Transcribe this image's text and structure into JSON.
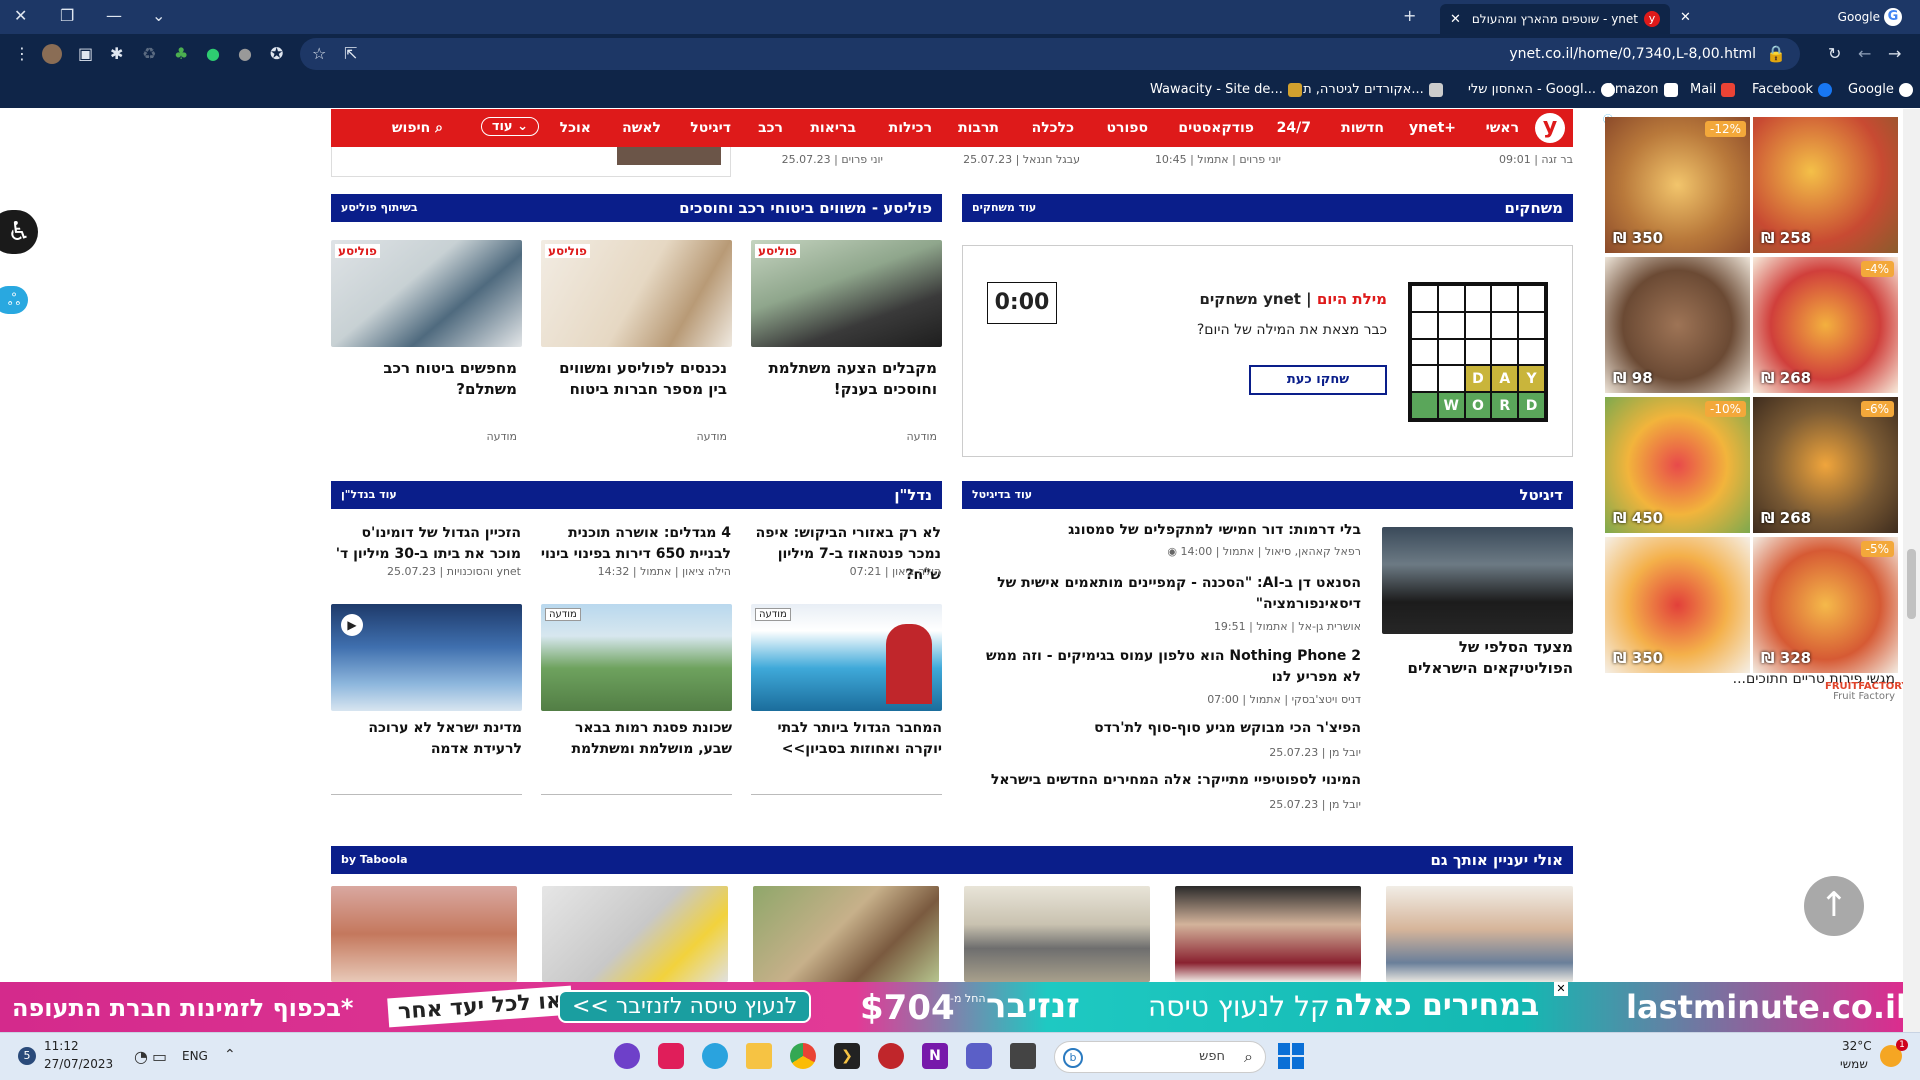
{
  "browser": {
    "tabs": [
      {
        "title": "Google",
        "active": false
      },
      {
        "title": "ynet - שוטפים מהארץ ומהעולם ם",
        "active": true
      }
    ],
    "url": "ynet.co.il/home/0,7340,L-8,00.html",
    "bookmarks": [
      {
        "label": "Google"
      },
      {
        "label": "Facebook"
      },
      {
        "label": "Mail"
      },
      {
        "label": "Amazon"
      },
      {
        "label": "האחסון שלי - Googl..."
      },
      {
        "label": "אקורדים לגיטרה, תוו..."
      },
      {
        "label": "Wawacity - Site de..."
      }
    ]
  },
  "nav": {
    "logo": "y",
    "items": [
      "ראשי",
      "ynet+",
      "חדשות",
      "24/7",
      "פודקאסטים",
      "ספורט",
      "כלכלה",
      "תרבות",
      "רכילות",
      "בריאות",
      "רכב",
      "דיגיטל",
      "לאשה",
      "אוכל"
    ],
    "more": "עוד",
    "search": "חיפוש"
  },
  "top_meta": [
    {
      "author": "בר זגה",
      "time": "09:01"
    },
    {
      "author": "יוני פרוים | אתמול",
      "time": "10:45"
    },
    {
      "author": "עבגל חננאל",
      "time": "25.07.23"
    },
    {
      "author": "יוני פרוים",
      "time": "25.07.23"
    }
  ],
  "games": {
    "title": "משחקים",
    "more": "עוד משחקים",
    "brand_red": "מילת היום",
    "brand_black": "ynet משחקים",
    "question": "כבר מצאת את המילה של היום?",
    "button": "שחקו כעת",
    "timer": "0:00",
    "grid_row4": [
      "Y",
      "A",
      "D"
    ],
    "grid_row5": [
      "D",
      "R",
      "O",
      "W"
    ]
  },
  "polisa": {
    "title": "פוליסע - משווים ביטוחי רכב וחוסכים",
    "partner": "בשיתוף פוליסע",
    "logo_text": "פוליסע",
    "cards": [
      {
        "headline": "מקבלים הצעה משתלמת וחוסכים בענק!",
        "label": "מודעה"
      },
      {
        "headline": "נכנסים לפוליסע ומשווים בין מספר חברות ביטוח",
        "label": "מודעה"
      },
      {
        "headline": "מחפשים ביטוח רכב משתלם?",
        "label": "מודעה"
      }
    ]
  },
  "digital": {
    "title": "דיגיטל",
    "more": "עוד בדיגיטל",
    "main_headline": "מצעד הסלפי של הפוליטיקאים הישראלים",
    "items": [
      {
        "headline": "בלי דרמות: דור חמישי למתקפלים של סמסונג",
        "meta": "רפאל קאהאן, סיאול | אתמול | 14:00"
      },
      {
        "headline": "הסנאט דן ב-AI: \"הסכנה - קמפיינים מותאמים אישית של דיסאינפורמציה\"",
        "meta": "אושרית גן-אל | אתמול | 19:51"
      },
      {
        "headline": "Nothing Phone 2 הוא טלפון עמוס בגימיקים - וזה ממש לא מפריע לנו",
        "meta": "דניס ויטצ'בסקי | אתמול | 07:00"
      },
      {
        "headline": "הפיצ'ר הכי מבוקש מגיע סוף-סוף לת'רדס",
        "meta": "יובל מן | 25.07.23"
      },
      {
        "headline": "המינוי לספוטיפיי מתייקר: אלה המחירים החדשים בישראל",
        "meta": "יובל מן | 25.07.23"
      }
    ]
  },
  "nadlan": {
    "title": "נדל\"ן",
    "more": "עוד בנדל\"ן",
    "text_items": [
      {
        "headline": "לא רק באזורי הביקוש: איפה נמכר פנטהאוז ב-7 מיליון ש\"ח?",
        "meta": "הילה ציאון | 07:21"
      },
      {
        "headline": "4 מגדלים: אושרה תוכנית לבניית 650 דירות בפינוי בינוי",
        "meta": "הילה ציאון | אתמול | 14:32"
      },
      {
        "headline": "הזכיין הגדול של דומינו'ס מוכר את ביתו ב-30 מיליון ד'",
        "meta": "ynet והסוכנויות | 25.07.23"
      }
    ],
    "image_items": [
      {
        "headline": "המחבר הגדול ביותר לבתי יוקרה ואחוזות בסביון>>",
        "label": "מודעה"
      },
      {
        "headline": "שכונת פסגת רמות בבאר שבע, מושלמת ומשתלמת",
        "label": "מודעה"
      },
      {
        "headline": "מדינת ישראל לא ערוכה לרעידת אדמה",
        "label": ""
      }
    ]
  },
  "taboola": {
    "title": "אולי יעניין אותך גם",
    "by": "by Taboola"
  },
  "right_ad": {
    "tiles": [
      {
        "price": "₪ 258",
        "discount": ""
      },
      {
        "price": "₪ 350",
        "discount": "-12%"
      },
      {
        "price": "₪ 268",
        "discount": "-4%"
      },
      {
        "price": "₪ 98",
        "discount": ""
      },
      {
        "price": "₪ 268",
        "discount": "-6%"
      },
      {
        "price": "₪ 450",
        "discount": "-10%"
      },
      {
        "price": "₪ 328",
        "discount": "-5%"
      },
      {
        "price": "₪ 350",
        "discount": ""
      }
    ],
    "caption": "מגשי פירות טריים חתוכים...",
    "brand": "Fruit Factory",
    "logo": "FRUITFACTORY"
  },
  "banner": {
    "brand": "lastminute.co.il",
    "headline": "במחירים כאלה",
    "sub": "קל לנעוץ טיסה",
    "dest": "זנזיבר",
    "from": "החל מ-",
    "price": "$704",
    "cta": "לנעוץ טיסה לזנזיבר >>",
    "tag": "או לכל יעד אחר",
    "note": "*בכפוף לזמינות חברת התעופה"
  },
  "taskbar": {
    "time": "11:12",
    "date": "27/07/2023",
    "lang": "ENG",
    "search": "חפש",
    "weather": "32°C",
    "weather_desc": "שמשי"
  }
}
